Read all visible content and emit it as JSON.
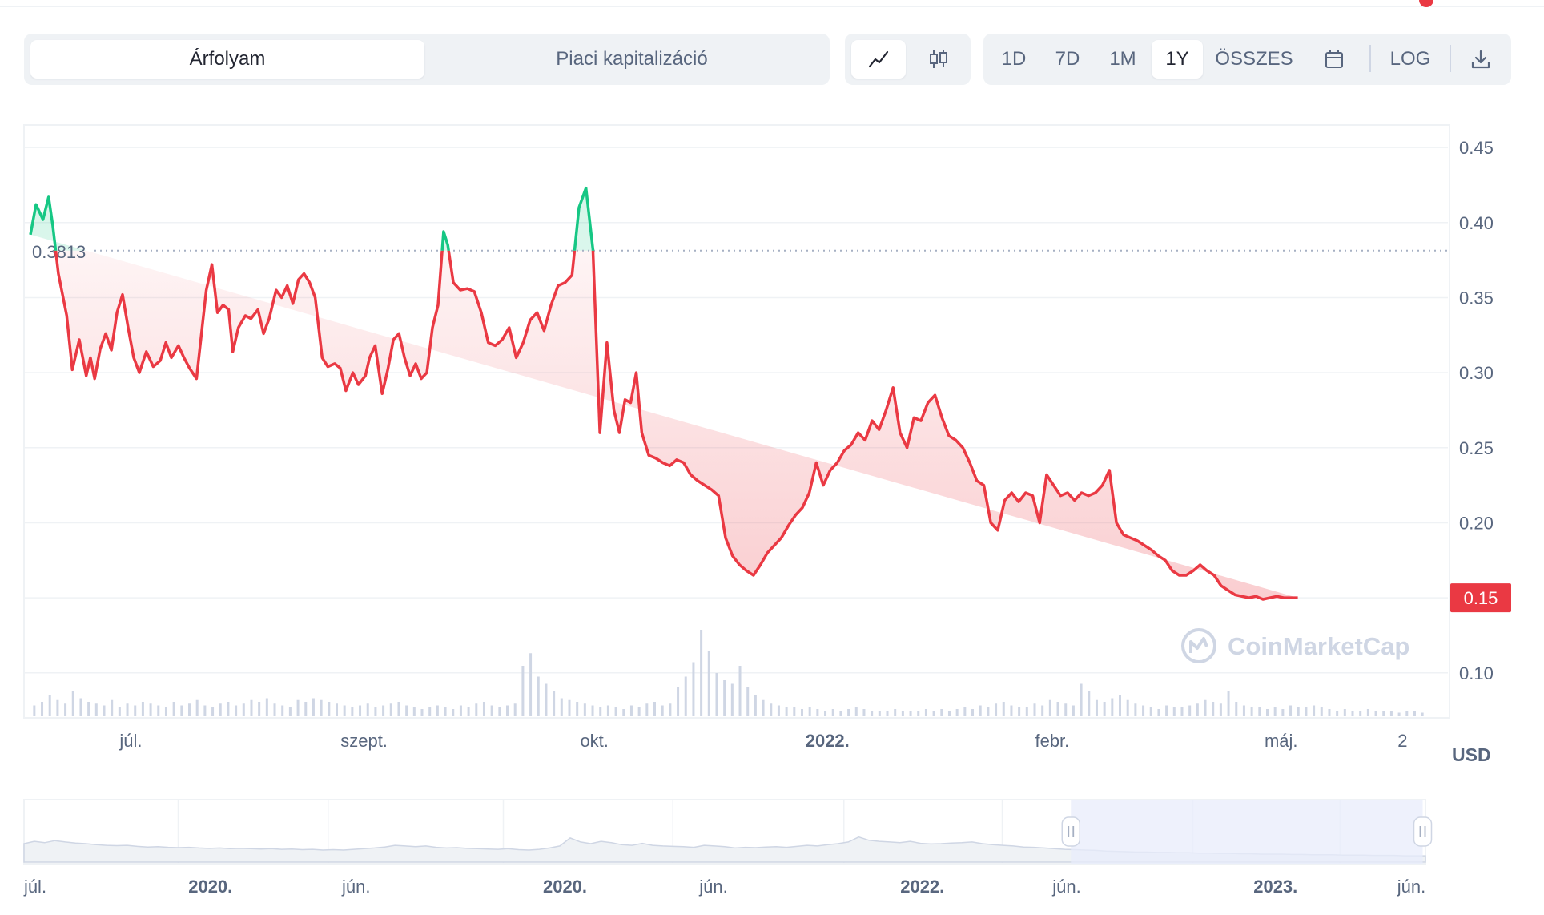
{
  "tabs": [
    {
      "label": "Árfolyam",
      "active": true
    },
    {
      "label": "Piaci kapitalizáció",
      "active": false
    }
  ],
  "chart_types": [
    {
      "icon": "line-chart-icon",
      "active": true
    },
    {
      "icon": "candlestick-icon",
      "active": false
    }
  ],
  "ranges": [
    {
      "label": "1D",
      "active": false
    },
    {
      "label": "7D",
      "active": false
    },
    {
      "label": "1M",
      "active": false
    },
    {
      "label": "1Y",
      "active": true
    },
    {
      "label": "ÖSSZES",
      "active": false
    }
  ],
  "toolbar": {
    "calendar_icon": "calendar-icon",
    "log_label": "LOG",
    "download_icon": "download-icon"
  },
  "watermark": "CoinMarketCap",
  "currency": "USD",
  "colors": {
    "up": "#16c784",
    "down": "#ea3943",
    "baseline": "#a6b0c3",
    "volume": "#cfd6e4",
    "navigator_selection": "#e8ecfb"
  },
  "chart_data": {
    "type": "line",
    "baseline_value": 0.3813,
    "baseline_label": "0.3813",
    "current_value": 0.15,
    "current_label": "0.15",
    "ylim": [
      0.07,
      0.465
    ],
    "y_ticks": [
      0.45,
      0.4,
      0.35,
      0.3,
      0.25,
      0.2,
      0.1
    ],
    "y_tick_labels": [
      "0.45",
      "0.40",
      "0.35",
      "0.30",
      "0.25",
      "0.20",
      "0.10"
    ],
    "x_tick_labels": [
      {
        "label": "júl.",
        "bold": false,
        "t": 0.072
      },
      {
        "label": "szept.",
        "bold": false,
        "t": 0.239
      },
      {
        "label": "okt.",
        "bold": false,
        "t": 0.404
      },
      {
        "label": "2022.",
        "bold": true,
        "t": 0.571
      },
      {
        "label": "febr.",
        "bold": false,
        "t": 0.732
      },
      {
        "label": "máj.",
        "bold": false,
        "t": 0.896
      },
      {
        "label": "2",
        "bold": false,
        "t": 0.983
      }
    ],
    "series": [
      {
        "t": [
          0,
          0.004,
          0.009,
          0.013,
          0.016,
          0.02,
          0.026,
          0.03,
          0.035,
          0.04,
          0.043,
          0.046,
          0.05,
          0.054,
          0.058,
          0.062,
          0.066,
          0.07,
          0.074,
          0.078,
          0.083,
          0.088,
          0.093,
          0.097,
          0.101,
          0.106,
          0.11,
          0.114,
          0.119,
          0.123,
          0.126,
          0.13,
          0.134,
          0.138,
          0.142,
          0.145,
          0.149,
          0.154,
          0.158,
          0.163,
          0.167,
          0.171,
          0.176,
          0.18,
          0.184,
          0.188,
          0.192,
          0.196,
          0.2,
          0.204,
          0.209,
          0.213,
          0.218,
          0.222,
          0.226,
          0.231,
          0.235,
          0.24,
          0.243,
          0.247,
          0.252,
          0.256,
          0.26,
          0.264,
          0.268,
          0.272,
          0.276,
          0.28,
          0.284,
          0.288,
          0.292,
          0.296,
          0.299,
          0.303,
          0.308,
          0.313,
          0.318,
          0.323,
          0.328,
          0.333,
          0.338,
          0.343,
          0.348,
          0.353,
          0.358,
          0.363,
          0.368,
          0.373,
          0.378,
          0.383,
          0.388,
          0.393,
          0.398,
          0.403,
          0.408,
          0.413,
          0.418,
          0.422,
          0.426,
          0.43,
          0.434,
          0.438,
          0.443,
          0.448,
          0.453,
          0.458,
          0.463,
          0.468,
          0.473,
          0.478,
          0.483,
          0.488,
          0.493,
          0.498,
          0.503,
          0.508,
          0.513,
          0.518,
          0.523,
          0.528,
          0.533,
          0.538,
          0.543,
          0.548,
          0.553,
          0.558,
          0.563,
          0.568,
          0.573,
          0.578,
          0.583,
          0.588,
          0.593,
          0.598,
          0.603,
          0.608,
          0.613,
          0.618,
          0.623,
          0.628,
          0.633,
          0.638,
          0.643,
          0.648,
          0.653,
          0.658,
          0.663,
          0.668,
          0.673,
          0.678,
          0.683,
          0.688,
          0.693,
          0.698,
          0.703,
          0.708,
          0.713,
          0.718,
          0.723,
          0.728,
          0.733,
          0.738,
          0.743,
          0.748,
          0.753,
          0.758,
          0.763,
          0.768,
          0.773,
          0.778,
          0.783,
          0.788,
          0.793,
          0.798,
          0.803,
          0.808,
          0.813,
          0.818,
          0.823,
          0.828,
          0.833,
          0.838,
          0.843,
          0.848,
          0.853,
          0.858,
          0.863,
          0.868,
          0.873,
          0.878,
          0.883,
          0.888,
          0.893,
          0.898,
          0.903,
          0.908,
          0.913,
          0.918,
          0.923,
          0.928,
          0.933,
          0.938,
          0.943,
          0.948,
          0.953,
          0.958,
          0.963,
          0.968,
          0.973,
          0.978,
          0.983,
          0.988,
          0.993,
          1.0
        ],
        "values": [
          0.392,
          0.412,
          0.402,
          0.417,
          0.398,
          0.366,
          0.338,
          0.302,
          0.322,
          0.298,
          0.31,
          0.296,
          0.316,
          0.326,
          0.315,
          0.34,
          0.352,
          0.33,
          0.31,
          0.3,
          0.314,
          0.304,
          0.308,
          0.32,
          0.31,
          0.318,
          0.31,
          0.303,
          0.296,
          0.33,
          0.355,
          0.372,
          0.34,
          0.345,
          0.342,
          0.314,
          0.33,
          0.338,
          0.336,
          0.342,
          0.326,
          0.336,
          0.355,
          0.35,
          0.358,
          0.346,
          0.362,
          0.366,
          0.36,
          0.35,
          0.31,
          0.304,
          0.306,
          0.303,
          0.288,
          0.3,
          0.292,
          0.298,
          0.31,
          0.318,
          0.286,
          0.302,
          0.322,
          0.326,
          0.31,
          0.298,
          0.306,
          0.296,
          0.3,
          0.33,
          0.345,
          0.394,
          0.385,
          0.36,
          0.355,
          0.356,
          0.354,
          0.34,
          0.32,
          0.318,
          0.322,
          0.33,
          0.31,
          0.32,
          0.335,
          0.34,
          0.328,
          0.345,
          0.358,
          0.36,
          0.365,
          0.41,
          0.423,
          0.382,
          0.26,
          0.32,
          0.275,
          0.26,
          0.282,
          0.28,
          0.3,
          0.26,
          0.245,
          0.243,
          0.24,
          0.238,
          0.242,
          0.24,
          0.232,
          0.228,
          0.225,
          0.222,
          0.218,
          0.19,
          0.178,
          0.172,
          0.168,
          0.165,
          0.172,
          0.18,
          0.185,
          0.19,
          0.198,
          0.205,
          0.21,
          0.22,
          0.24,
          0.225,
          0.235,
          0.24,
          0.248,
          0.252,
          0.26,
          0.255,
          0.268,
          0.262,
          0.275,
          0.29,
          0.26,
          0.25,
          0.27,
          0.268,
          0.28,
          0.285,
          0.27,
          0.258,
          0.255,
          0.25,
          0.24,
          0.228,
          0.225,
          0.2,
          0.195,
          0.215,
          0.22,
          0.214,
          0.22,
          0.218,
          0.2,
          0.232,
          0.225,
          0.218,
          0.22,
          0.215,
          0.22,
          0.218,
          0.22,
          0.225,
          0.235,
          0.2,
          0.192,
          0.19,
          0.188,
          0.185,
          0.182,
          0.178,
          0.175,
          0.168,
          0.165,
          0.165,
          0.168,
          0.172,
          0.168,
          0.165,
          0.158,
          0.155,
          0.152,
          0.151,
          0.15,
          0.151,
          0.149,
          0.15,
          0.151,
          0.15,
          0.15,
          0.15
        ]
      }
    ],
    "volume": [
      6,
      8,
      12,
      9,
      7,
      14,
      10,
      8,
      7,
      6,
      9,
      5,
      7,
      6,
      8,
      7,
      6,
      5,
      8,
      6,
      7,
      9,
      6,
      5,
      7,
      8,
      6,
      7,
      9,
      8,
      10,
      7,
      6,
      5,
      9,
      8,
      10,
      9,
      8,
      7,
      6,
      5,
      6,
      7,
      5,
      6,
      7,
      8,
      6,
      5,
      4,
      5,
      6,
      5,
      4,
      6,
      5,
      7,
      8,
      6,
      5,
      6,
      7,
      28,
      35,
      22,
      18,
      14,
      10,
      9,
      8,
      7,
      6,
      5,
      6,
      5,
      4,
      6,
      5,
      7,
      8,
      6,
      7,
      16,
      22,
      30,
      48,
      36,
      24,
      20,
      18,
      28,
      16,
      12,
      9,
      7,
      6,
      5,
      5,
      4,
      5,
      4,
      3,
      4,
      3,
      4,
      5,
      4,
      3,
      3,
      3,
      4,
      3,
      3,
      3,
      4,
      3,
      4,
      3,
      4,
      5,
      4,
      6,
      5,
      7,
      8,
      6,
      5,
      5,
      7,
      6,
      9,
      8,
      7,
      6,
      18,
      14,
      9,
      8,
      10,
      12,
      9,
      7,
      6,
      5,
      4,
      6,
      5,
      5,
      6,
      7,
      9,
      8,
      7,
      14,
      8,
      6,
      5,
      5,
      4,
      5,
      4,
      6,
      5,
      5,
      6,
      5,
      4,
      3,
      4,
      3,
      3,
      4,
      3,
      3,
      3,
      2,
      3,
      3,
      2
    ]
  },
  "navigator": {
    "x_tick_labels": [
      {
        "label": "júl.",
        "bold": false,
        "t": 0.008
      },
      {
        "label": "2020.",
        "bold": true,
        "t": 0.133
      },
      {
        "label": "jún.",
        "bold": false,
        "t": 0.237
      },
      {
        "label": "2020.",
        "bold": true,
        "t": 0.386
      },
      {
        "label": "jún.",
        "bold": false,
        "t": 0.492
      },
      {
        "label": "2022.",
        "bold": true,
        "t": 0.641
      },
      {
        "label": "jún.",
        "bold": false,
        "t": 0.744
      },
      {
        "label": "2023.",
        "bold": true,
        "t": 0.893
      },
      {
        "label": "jún.",
        "bold": false,
        "t": 0.99
      }
    ],
    "values": [
      0.55,
      0.62,
      0.58,
      0.64,
      0.6,
      0.57,
      0.55,
      0.52,
      0.5,
      0.49,
      0.5,
      0.47,
      0.45,
      0.46,
      0.44,
      0.43,
      0.44,
      0.42,
      0.41,
      0.42,
      0.4,
      0.41,
      0.4,
      0.39,
      0.4,
      0.38,
      0.39,
      0.37,
      0.38,
      0.36,
      0.37,
      0.36,
      0.38,
      0.4,
      0.42,
      0.45,
      0.5,
      0.48,
      0.46,
      0.48,
      0.44,
      0.42,
      0.43,
      0.41,
      0.4,
      0.39,
      0.38,
      0.4,
      0.37,
      0.36,
      0.38,
      0.42,
      0.48,
      0.72,
      0.6,
      0.55,
      0.62,
      0.58,
      0.52,
      0.5,
      0.56,
      0.5,
      0.48,
      0.47,
      0.46,
      0.44,
      0.5,
      0.48,
      0.46,
      0.42,
      0.44,
      0.43,
      0.45,
      0.46,
      0.44,
      0.47,
      0.5,
      0.48,
      0.52,
      0.55,
      0.6,
      0.75,
      0.65,
      0.62,
      0.6,
      0.58,
      0.62,
      0.56,
      0.54,
      0.55,
      0.57,
      0.58,
      0.6,
      0.55,
      0.52,
      0.5,
      0.48,
      0.45,
      0.44,
      0.42,
      0.4,
      0.38,
      0.37,
      0.36,
      0.35,
      0.33,
      0.32,
      0.31,
      0.3,
      0.3,
      0.29,
      0.29,
      0.28,
      0.28,
      0.27,
      0.27,
      0.26,
      0.26,
      0.25,
      0.25,
      0.24,
      0.24,
      0.24,
      0.23,
      0.23,
      0.22,
      0.22,
      0.22,
      0.21,
      0.21,
      0.21,
      0.2,
      0.2,
      0.2,
      0.19,
      0.19,
      0.19
    ],
    "selection": [
      0.747,
      0.998
    ]
  }
}
